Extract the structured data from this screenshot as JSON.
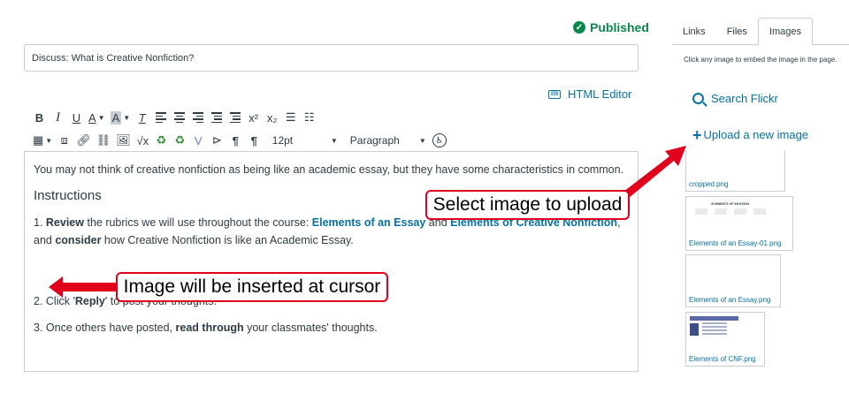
{
  "status": {
    "published": "Published"
  },
  "title": {
    "value": "Discuss: What is Creative Nonfiction?"
  },
  "html_editor": {
    "label": "HTML Editor"
  },
  "toolbar": {
    "row1": [
      "B",
      "I",
      "U",
      "A",
      "A",
      "T",
      "",
      "",
      "",
      "",
      "",
      "x²",
      "x₂",
      "",
      ""
    ],
    "font_size": "12pt",
    "paragraph": "Paragraph",
    "pilcrow_ltr": "¶",
    "pilcrow_rtl": "¶"
  },
  "editor": {
    "intro": "You may not think of creative nonfiction as being like an academic essay, but they have some characteristics in common.",
    "heading": "Instructions",
    "p1_num": "1. ",
    "p1_bold1": "Review",
    "p1_t1": " the rubrics we will use throughout the course: ",
    "p1_link1": "Elements of an Essay",
    "p1_t2": " and ",
    "p1_link2": "Elements of Creative Nonfiction",
    "p1_t3": ", and ",
    "p1_bold2": "consider",
    "p1_t4": " how Creative Nonfiction is like an Academic Essay.",
    "p2_t1": "2. Click '",
    "p2_bold": "Reply",
    "p2_t2": "' to post your thoughts.",
    "p3_t1": "3. Once others have posted, ",
    "p3_bold": "read through",
    "p3_t2": " your classmates' thoughts."
  },
  "sidebar": {
    "tabs": [
      "Links",
      "Files",
      "Images"
    ],
    "active_tab": "Images",
    "hint": "Click any image to embed the image in the page.",
    "search_flickr": "Search Flickr",
    "upload": "Upload a new image",
    "images": [
      {
        "name": "cropped.png"
      },
      {
        "name": "Elements of an Essay-01.png",
        "preview_title": "ELEMENTS OF AN ESSAY"
      },
      {
        "name": "Elements of an Essay.png"
      },
      {
        "name": "Elements of CNF.png"
      }
    ]
  },
  "callouts": {
    "upload": "Select image to upload",
    "cursor": "Image will be inserted at cursor"
  },
  "colors": {
    "accent": "#0770a3",
    "published": "#0b874b",
    "callout": "#e0001b"
  }
}
